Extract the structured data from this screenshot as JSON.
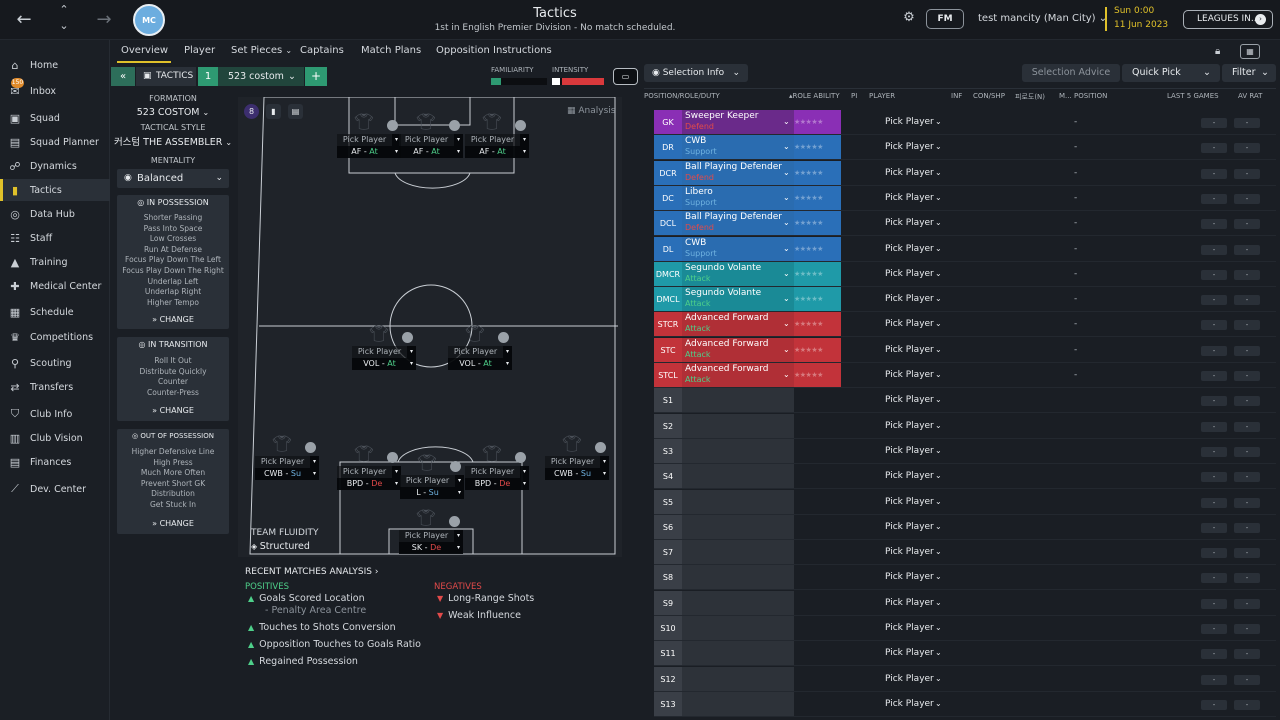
{
  "header": {
    "title": "Tactics",
    "subtitle": "1st in English Premier Division - No match scheduled.",
    "fm_label": "FM",
    "manager": "test mancity (Man City)",
    "time": "Sun 0:00",
    "date": "11 Jun 2023",
    "leagues_button": "LEAGUES IN..."
  },
  "sidebar": {
    "items": [
      {
        "label": "Home",
        "icon": "home-icon",
        "glyph": "⌂"
      },
      {
        "label": "Inbox",
        "icon": "inbox-icon",
        "glyph": "✉",
        "badge": "150"
      },
      {
        "label": "Squad",
        "icon": "squad-icon",
        "glyph": "▣"
      },
      {
        "label": "Squad Planner",
        "icon": "squad-planner-icon",
        "glyph": "▤"
      },
      {
        "label": "Dynamics",
        "icon": "dynamics-icon",
        "glyph": "☍"
      },
      {
        "label": "Tactics",
        "icon": "tactics-icon",
        "glyph": "▮"
      },
      {
        "label": "Data Hub",
        "icon": "data-hub-icon",
        "glyph": "◎"
      },
      {
        "label": "Staff",
        "icon": "staff-icon",
        "glyph": "☷"
      },
      {
        "label": "Training",
        "icon": "training-icon",
        "glyph": "▲"
      },
      {
        "label": "Medical Center",
        "icon": "medical-icon",
        "glyph": "✚"
      },
      {
        "label": "Schedule",
        "icon": "schedule-icon",
        "glyph": "▦"
      },
      {
        "label": "Competitions",
        "icon": "competitions-icon",
        "glyph": "♛"
      },
      {
        "label": "Scouting",
        "icon": "scouting-icon",
        "glyph": "⚲"
      },
      {
        "label": "Transfers",
        "icon": "transfers-icon",
        "glyph": "⇄"
      },
      {
        "label": "Club Info",
        "icon": "club-info-icon",
        "glyph": "⛉"
      },
      {
        "label": "Club Vision",
        "icon": "club-vision-icon",
        "glyph": "▥"
      },
      {
        "label": "Finances",
        "icon": "finances-icon",
        "glyph": "▤"
      },
      {
        "label": "Dev. Center",
        "icon": "dev-center-icon",
        "glyph": "⟋"
      }
    ]
  },
  "tabs": [
    "Overview",
    "Player",
    "Set Pieces",
    "Captains",
    "Match Plans",
    "Opposition Instructions"
  ],
  "toolbar": {
    "tactics_label": "TACTICS",
    "tactic_number": "1",
    "tactic_name": "523 costom",
    "familiarity_label": "FAMILIARITY",
    "intensity_label": "INTENSITY",
    "familiarity_level": 0.18,
    "intensity_level": 0.8
  },
  "left_panel": {
    "formation_label": "FORMATION",
    "formation_value": "523 COSTOM",
    "style_label": "TACTICAL STYLE",
    "style_value": "커스텀 THE ASSEMBLER",
    "mentality_label": "MENTALITY",
    "mentality_value": "Balanced",
    "in_possession": {
      "title": "IN POSSESSION",
      "items": [
        "Shorter Passing",
        "Pass Into Space",
        "Low Crosses",
        "Run At Defense",
        "Focus Play Down The Left",
        "Focus Play Down The Right",
        "Underlap Left",
        "Underlap Right",
        "Higher Tempo"
      ],
      "change": "CHANGE"
    },
    "in_transition": {
      "title": "IN TRANSITION",
      "items": [
        "Roll It Out",
        "Distribute Quickly",
        "Counter",
        "Counter-Press"
      ],
      "change": "CHANGE"
    },
    "out_of_possession": {
      "title": "OUT OF POSSESSION",
      "items": [
        "Higher Defensive Line",
        "High Press",
        "Much More Often",
        "Prevent Short GK",
        "Distribution",
        "Get Stuck In"
      ],
      "change": "CHANGE"
    }
  },
  "pitch": {
    "analysis_label": "Analysis",
    "fluidity_label": "TEAM FLUIDITY",
    "fluidity_value": "Structured",
    "pick_label": "Pick Player",
    "players": [
      {
        "role": "AF",
        "duty": "At",
        "cls": "att"
      },
      {
        "role": "AF",
        "duty": "At",
        "cls": "att"
      },
      {
        "role": "AF",
        "duty": "At",
        "cls": "att"
      },
      {
        "role": "VOL",
        "duty": "At",
        "cls": "att"
      },
      {
        "role": "VOL",
        "duty": "At",
        "cls": "att"
      },
      {
        "role": "CWB",
        "duty": "Su",
        "cls": "sup"
      },
      {
        "role": "BPD",
        "duty": "De",
        "cls": "def"
      },
      {
        "role": "L",
        "duty": "Su",
        "cls": "sup"
      },
      {
        "role": "BPD",
        "duty": "De",
        "cls": "def"
      },
      {
        "role": "CWB",
        "duty": "Su",
        "cls": "sup"
      },
      {
        "role": "SK",
        "duty": "De",
        "cls": "def"
      }
    ]
  },
  "analysis": {
    "title": "RECENT MATCHES ANALYSIS",
    "positives_title": "POSITIVES",
    "negatives_title": "NEGATIVES",
    "positives": [
      "Goals Scored Location",
      "- Penalty Area Centre",
      "Touches to Shots Conversion",
      "Opposition Touches to Goals Ratio",
      "Regained Possession"
    ],
    "negatives": [
      "Long-Range Shots",
      "Weak Influence"
    ]
  },
  "right_panel": {
    "selection_info": "Selection Info",
    "selection_advice": "Selection Advice",
    "quick_pick": "Quick Pick",
    "filter": "Filter",
    "columns": [
      "POSITION/ROLE/DUTY",
      "ROLE ABILITY",
      "PI",
      "PLAYER",
      "INF",
      "CON/SHP",
      "피로도(N)",
      "M...",
      "POSITION",
      "LAST 5 GAMES",
      "AV RAT"
    ],
    "pick_label": "Pick Player",
    "dash": "-",
    "rows": [
      {
        "pos": "GK",
        "role": "Sweeper Keeper",
        "duty": "Defend",
        "cls": "gk",
        "rcls": "gkr",
        "dcls": "def"
      },
      {
        "pos": "DR",
        "role": "CWB",
        "duty": "Support",
        "cls": "d",
        "rcls": "dr2",
        "dcls": "sup"
      },
      {
        "pos": "DCR",
        "role": "Ball Playing Defender",
        "duty": "Defend",
        "cls": "d",
        "rcls": "dr2",
        "dcls": "def"
      },
      {
        "pos": "DC",
        "role": "Libero",
        "duty": "Support",
        "cls": "d",
        "rcls": "dr2",
        "dcls": "sup"
      },
      {
        "pos": "DCL",
        "role": "Ball Playing Defender",
        "duty": "Defend",
        "cls": "d",
        "rcls": "dr2",
        "dcls": "def"
      },
      {
        "pos": "DL",
        "role": "CWB",
        "duty": "Support",
        "cls": "d",
        "rcls": "dr2",
        "dcls": "sup"
      },
      {
        "pos": "DMCR",
        "role": "Segundo Volante",
        "duty": "Attack",
        "cls": "m",
        "rcls": "mr",
        "dcls": "att"
      },
      {
        "pos": "DMCL",
        "role": "Segundo Volante",
        "duty": "Attack",
        "cls": "m",
        "rcls": "mr",
        "dcls": "att"
      },
      {
        "pos": "STCR",
        "role": "Advanced Forward",
        "duty": "Attack",
        "cls": "a",
        "rcls": "ar",
        "dcls": "att"
      },
      {
        "pos": "STC",
        "role": "Advanced Forward",
        "duty": "Attack",
        "cls": "a",
        "rcls": "ar",
        "dcls": "att"
      },
      {
        "pos": "STCL",
        "role": "Advanced Forward",
        "duty": "Attack",
        "cls": "a",
        "rcls": "ar",
        "dcls": "att"
      },
      {
        "pos": "S1"
      },
      {
        "pos": "S2"
      },
      {
        "pos": "S3"
      },
      {
        "pos": "S4"
      },
      {
        "pos": "S5"
      },
      {
        "pos": "S6"
      },
      {
        "pos": "S7"
      },
      {
        "pos": "S8"
      },
      {
        "pos": "S9"
      },
      {
        "pos": "S10"
      },
      {
        "pos": "S11"
      },
      {
        "pos": "S12"
      },
      {
        "pos": "S13"
      }
    ]
  }
}
